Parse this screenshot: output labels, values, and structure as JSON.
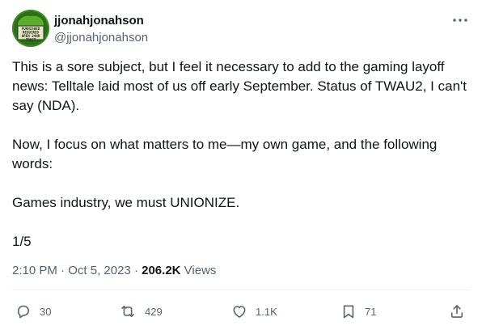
{
  "author": {
    "display_name": "jjonahjonahson",
    "handle": "@jjonahjonahson",
    "avatar_text": [
      "FURNISHED",
      "REQUIRED",
      "OPEN 24HR",
      "TRACT"
    ]
  },
  "tweet": {
    "text": "This is a sore subject, but I feel it necessary to add to the gaming layoff news: Telltale laid most of us off early September. Status of TWAU2, I can't say (NDA).\n\nNow, I focus on what matters to me—my own game, and the following words:\n\nGames industry, we must UNIONIZE.\n\n1/5"
  },
  "meta": {
    "time": "2:10 PM",
    "sep1": " · ",
    "date": "Oct 5, 2023",
    "sep2": " · ",
    "views_count": "206.2K",
    "views_label": " Views"
  },
  "actions": {
    "replies": "30",
    "reposts": "429",
    "likes": "1.1K",
    "bookmarks": "71"
  },
  "icons": [
    "more-icon",
    "reply-icon",
    "repost-icon",
    "like-icon",
    "bookmark-icon",
    "share-icon"
  ],
  "colors": {
    "text": "#0f1419",
    "secondary": "#536471",
    "avatar_bg": "#2f7d1e"
  }
}
